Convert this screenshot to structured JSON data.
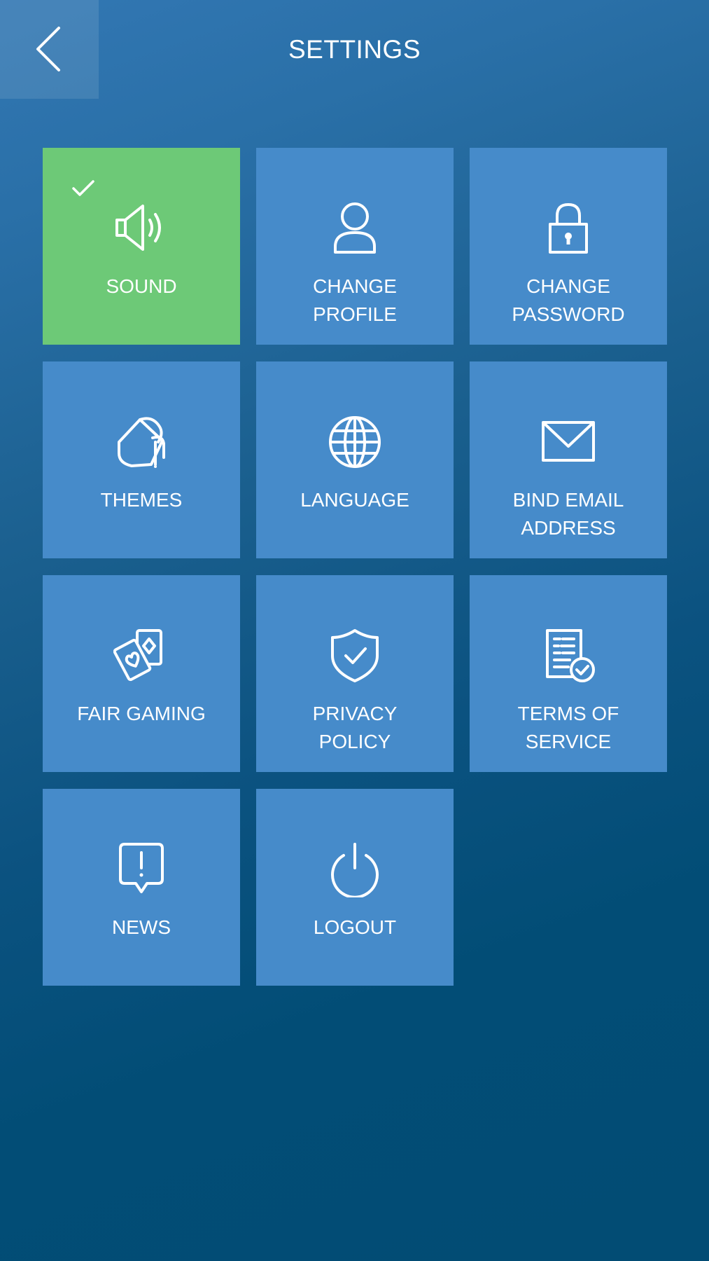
{
  "header": {
    "title": "SETTINGS",
    "back_icon": "chevron-left-icon"
  },
  "colors": {
    "tile": "#468bca",
    "tile_active": "#6dc977",
    "background_top": "#3277b3",
    "background_bottom": "#024c74"
  },
  "tiles": [
    {
      "label": "SOUND",
      "icon": "speaker-icon",
      "active": true
    },
    {
      "label": "CHANGE\nPROFILE",
      "icon": "user-icon",
      "active": false
    },
    {
      "label": "CHANGE\nPASSWORD",
      "icon": "lock-icon",
      "active": false
    },
    {
      "label": "THEMES",
      "icon": "paint-bucket-icon",
      "active": false
    },
    {
      "label": "LANGUAGE",
      "icon": "globe-icon",
      "active": false
    },
    {
      "label": "BIND EMAIL\nADDRESS",
      "icon": "envelope-icon",
      "active": false
    },
    {
      "label": "FAIR GAMING",
      "icon": "playing-cards-icon",
      "active": false
    },
    {
      "label": "PRIVACY\nPOLICY",
      "icon": "shield-check-icon",
      "active": false
    },
    {
      "label": "TERMS OF\nSERVICE",
      "icon": "document-check-icon",
      "active": false
    },
    {
      "label": "NEWS",
      "icon": "alert-bubble-icon",
      "active": false
    },
    {
      "label": "LOGOUT",
      "icon": "power-icon",
      "active": false
    }
  ]
}
